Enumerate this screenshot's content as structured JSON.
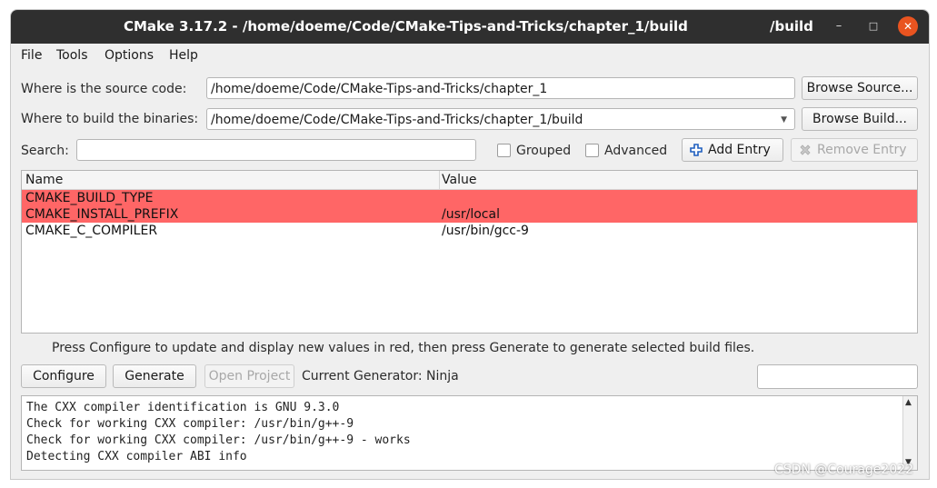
{
  "titlebar": {
    "title": "CMake 3.17.2 - /home/doeme/Code/CMake-Tips-and-Tricks/chapter_1/build",
    "title_extra": "/build",
    "minimize_glyph": "–",
    "maximize_glyph": "□",
    "close_glyph": "✕"
  },
  "menu": {
    "file": "File",
    "tools": "Tools",
    "options": "Options",
    "help": "Help"
  },
  "source": {
    "label": "Where is the source code:",
    "value": "/home/doeme/Code/CMake-Tips-and-Tricks/chapter_1",
    "browse_label": "Browse Source..."
  },
  "build": {
    "label": "Where to build the binaries:",
    "value": "/home/doeme/Code/CMake-Tips-and-Tricks/chapter_1/build",
    "browse_label": "Browse Build..."
  },
  "search": {
    "label": "Search:",
    "value": "",
    "grouped_label": "Grouped",
    "grouped_checked": false,
    "advanced_label": "Advanced",
    "advanced_checked": false,
    "add_entry_label": "Add Entry",
    "remove_entry_label": "Remove Entry"
  },
  "table": {
    "columns": [
      "Name",
      "Value"
    ],
    "rows": [
      {
        "name": "CMAKE_BUILD_TYPE",
        "value": "",
        "highlight": true
      },
      {
        "name": "CMAKE_INSTALL_PREFIX",
        "value": "/usr/local",
        "highlight": true
      },
      {
        "name": "CMAKE_C_COMPILER",
        "value": "/usr/bin/gcc-9",
        "highlight": false
      }
    ]
  },
  "info_text": "Press Configure to update and display new values in red, then press Generate to generate selected build files.",
  "actions": {
    "configure_label": "Configure",
    "generate_label": "Generate",
    "open_project_label": "Open Project",
    "generator_text": "Current Generator: Ninja",
    "progress_value": ""
  },
  "log": {
    "lines": [
      "The CXX compiler identification is GNU 9.3.0",
      "Check for working CXX compiler: /usr/bin/g++-9",
      "Check for working CXX compiler: /usr/bin/g++-9 - works",
      "Detecting CXX compiler ABI info"
    ]
  },
  "watermark": "CSDN @Courage2022",
  "colors": {
    "highlight_row": "#ff6666",
    "titlebar": "#2f2f2f",
    "close_button": "#e95420",
    "add_icon": "#1f5fbf"
  }
}
